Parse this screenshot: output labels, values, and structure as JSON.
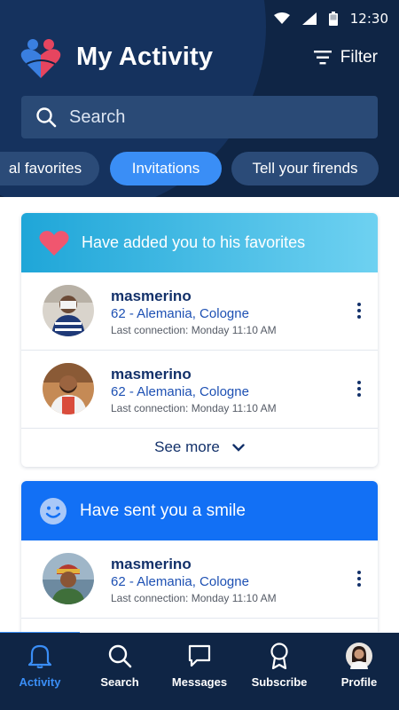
{
  "status": {
    "time": "12:30"
  },
  "header": {
    "title": "My Activity",
    "filter_label": "Filter"
  },
  "search": {
    "placeholder": "Search"
  },
  "tabs": [
    {
      "label": "al favorites"
    },
    {
      "label": "Invitations",
      "active": true
    },
    {
      "label": "Tell your firends"
    }
  ],
  "sections": [
    {
      "title": "Have added you to his favorites",
      "icon": "heart-icon",
      "items": [
        {
          "name": "masmerino",
          "location": "62 - Alemania, Cologne",
          "last": "Last connection: Monday 11:10 AM"
        },
        {
          "name": "masmerino",
          "location": "62 - Alemania, Cologne",
          "last": "Last connection: Monday 11:10 AM"
        }
      ],
      "see_more": "See more"
    },
    {
      "title": "Have sent you a smile",
      "icon": "smile-icon",
      "items": [
        {
          "name": "masmerino",
          "location": "62 - Alemania, Cologne",
          "last": "Last connection: Monday 11:10 AM"
        }
      ]
    }
  ],
  "nav": [
    {
      "label": "Activity",
      "icon": "bell-icon",
      "active": true
    },
    {
      "label": "Search",
      "icon": "search-icon"
    },
    {
      "label": "Messages",
      "icon": "message-icon"
    },
    {
      "label": "Subscribe",
      "icon": "badge-icon"
    },
    {
      "label": "Profile",
      "icon": "profile-avatar"
    }
  ],
  "colors": {
    "navy": "#0f2545",
    "accent": "#3a8ef6",
    "name": "#13316a",
    "location": "#1d50b3"
  }
}
